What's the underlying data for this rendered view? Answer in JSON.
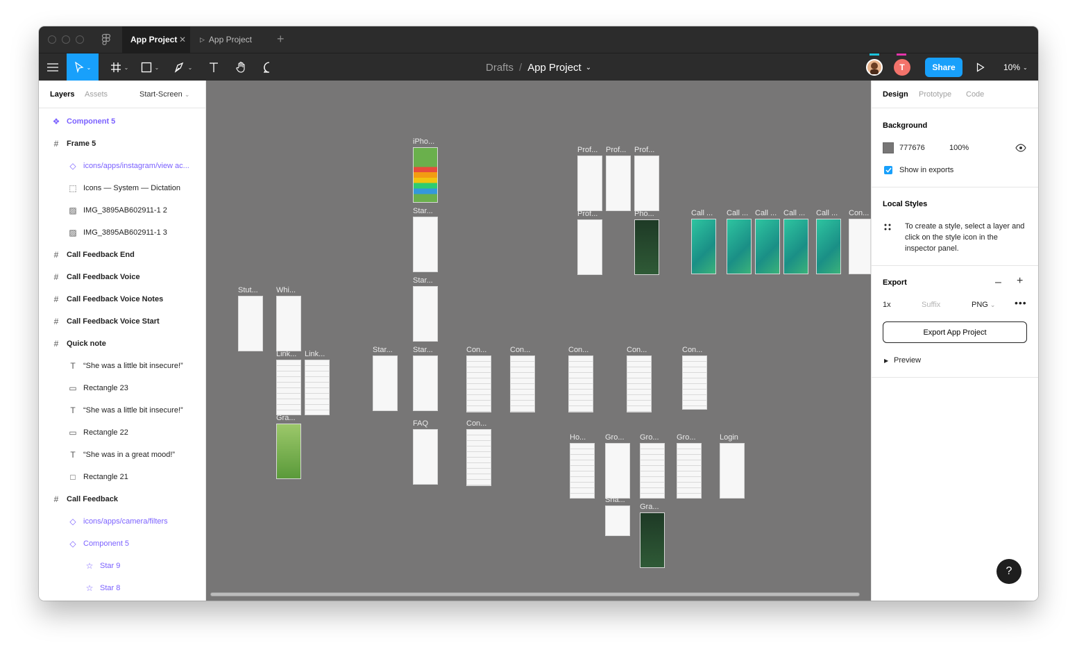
{
  "tabs": [
    {
      "label": "App Project",
      "active": true
    },
    {
      "label": "App Project",
      "active": false
    }
  ],
  "breadcrumb": {
    "parent": "Drafts",
    "separator": "/",
    "current": "App Project"
  },
  "toolbar": {
    "share_label": "Share",
    "zoom": "10%",
    "avatar_letter": "T"
  },
  "colors": {
    "accent": "#18a0fb",
    "canvas": "#777676",
    "component": "#7b61ff"
  },
  "left_panel": {
    "tabs": [
      "Layers",
      "Assets"
    ],
    "page": "Start-Screen",
    "layers": [
      {
        "label": "Component 5",
        "icon": "component-icon",
        "level": 0,
        "style": "purple-bold"
      },
      {
        "label": "Frame 5",
        "icon": "frame-icon",
        "level": 0,
        "style": "bold"
      },
      {
        "label": "icons/apps/instagram/view ac...",
        "icon": "instance-icon",
        "level": 1,
        "style": "purple"
      },
      {
        "label": "Icons — System — Dictation",
        "icon": "group-icon",
        "level": 1,
        "style": "normal"
      },
      {
        "label": "IMG_3895AB602911-1 2",
        "icon": "image-icon",
        "level": 1,
        "style": "normal"
      },
      {
        "label": "IMG_3895AB602911-1 3",
        "icon": "image-icon",
        "level": 1,
        "style": "normal"
      },
      {
        "label": "Call Feedback End",
        "icon": "frame-icon",
        "level": 0,
        "style": "bold"
      },
      {
        "label": "Call Feedback Voice",
        "icon": "frame-icon",
        "level": 0,
        "style": "bold"
      },
      {
        "label": "Call Feedback Voice Notes",
        "icon": "frame-icon",
        "level": 0,
        "style": "bold"
      },
      {
        "label": "Call Feedback Voice Start",
        "icon": "frame-icon",
        "level": 0,
        "style": "bold"
      },
      {
        "label": "Quick note",
        "icon": "frame-icon",
        "level": 0,
        "style": "bold"
      },
      {
        "label": "“She was a little bit insecure!”",
        "icon": "text-icon",
        "level": 1,
        "style": "normal"
      },
      {
        "label": "Rectangle 23",
        "icon": "rectangle-icon",
        "level": 1,
        "style": "normal"
      },
      {
        "label": "“She was a little bit insecure!”",
        "icon": "text-icon",
        "level": 1,
        "style": "normal"
      },
      {
        "label": "Rectangle 22",
        "icon": "rectangle-icon",
        "level": 1,
        "style": "normal"
      },
      {
        "label": "“She was in a great mood!”",
        "icon": "text-icon",
        "level": 1,
        "style": "normal"
      },
      {
        "label": "Rectangle 21",
        "icon": "rectangle-outline-icon",
        "level": 1,
        "style": "normal"
      },
      {
        "label": "Call Feedback",
        "icon": "frame-icon",
        "level": 0,
        "style": "bold"
      },
      {
        "label": "icons/apps/camera/filters",
        "icon": "instance-icon",
        "level": 1,
        "style": "purple"
      },
      {
        "label": "Component 5",
        "icon": "instance-icon",
        "level": 1,
        "style": "purple"
      },
      {
        "label": "Star 9",
        "icon": "star-icon",
        "level": 2,
        "style": "purple"
      },
      {
        "label": "Star 8",
        "icon": "star-icon",
        "level": 2,
        "style": "purple"
      }
    ]
  },
  "canvas": {
    "frames": [
      {
        "label": "iPho...",
        "kind": "rainbow"
      },
      {
        "label": "Star...",
        "kind": "white"
      },
      {
        "label": "Star...",
        "kind": "white"
      },
      {
        "label": "Stut...",
        "kind": "white"
      },
      {
        "label": "Whi...",
        "kind": "white"
      },
      {
        "label": "Link...",
        "kind": "list"
      },
      {
        "label": "Link...",
        "kind": "list"
      },
      {
        "label": "Gra...",
        "kind": "green"
      },
      {
        "label": "Star...",
        "kind": "white"
      },
      {
        "label": "Star...",
        "kind": "white"
      },
      {
        "label": "Con...",
        "kind": "list"
      },
      {
        "label": "Con...",
        "kind": "list"
      },
      {
        "label": "Con...",
        "kind": "list"
      },
      {
        "label": "Con...",
        "kind": "list"
      },
      {
        "label": "Con...",
        "kind": "list"
      },
      {
        "label": "FAQ",
        "kind": "white"
      },
      {
        "label": "Con...",
        "kind": "list"
      },
      {
        "label": "Prof...",
        "kind": "white"
      },
      {
        "label": "Prof...",
        "kind": "white"
      },
      {
        "label": "Prof...",
        "kind": "white"
      },
      {
        "label": "Prof...",
        "kind": "white"
      },
      {
        "label": "Pho...",
        "kind": "dark"
      },
      {
        "label": "Call ...",
        "kind": "teal"
      },
      {
        "label": "Call ...",
        "kind": "teal"
      },
      {
        "label": "Call ...",
        "kind": "teal"
      },
      {
        "label": "Call ...",
        "kind": "teal"
      },
      {
        "label": "Call ...",
        "kind": "teal"
      },
      {
        "label": "Con...",
        "kind": "white"
      },
      {
        "label": "Ho...",
        "kind": "list"
      },
      {
        "label": "Gro...",
        "kind": "white"
      },
      {
        "label": "Gro...",
        "kind": "list"
      },
      {
        "label": "Gro...",
        "kind": "list"
      },
      {
        "label": "Login",
        "kind": "white"
      },
      {
        "label": "Sha...",
        "kind": "white"
      },
      {
        "label": "Gra...",
        "kind": "dark"
      }
    ]
  },
  "right_panel": {
    "tabs": [
      "Design",
      "Prototype",
      "Code"
    ],
    "background": {
      "title": "Background",
      "hex": "777676",
      "opacity": "100%",
      "show_in_exports": "Show in exports"
    },
    "local_styles": {
      "title": "Local Styles",
      "hint": "To create a style, select a layer and click on the style icon in the inspector panel."
    },
    "export": {
      "title": "Export",
      "scale": "1x",
      "suffix_placeholder": "Suffix",
      "format": "PNG",
      "button": "Export App Project",
      "preview": "Preview"
    },
    "help": "?"
  }
}
